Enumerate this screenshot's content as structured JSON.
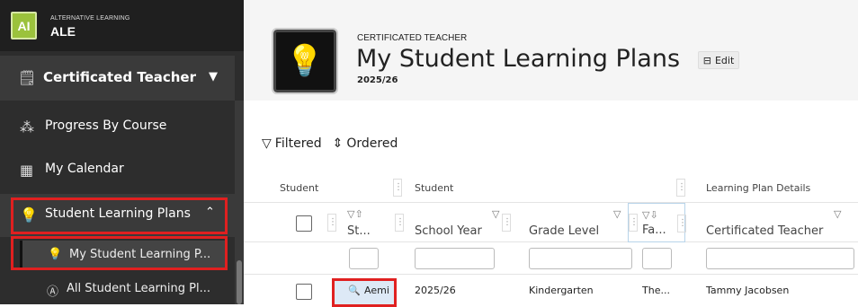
{
  "brand": {
    "logo": "AI",
    "subtitle": "ALTERNATIVE LEARNING",
    "name": "ALE"
  },
  "sidebar": {
    "role": {
      "icon": "teacher-icon",
      "label": "Certificated Teacher"
    },
    "items": [
      {
        "icon": "hierarchy-icon",
        "label": "Progress By Course"
      },
      {
        "icon": "calendar-icon",
        "label": "My Calendar"
      },
      {
        "icon": "lightbulb-icon",
        "label": "Student Learning Plans"
      }
    ],
    "subitems": [
      {
        "icon": "lightbulb-icon",
        "label": "My Student Learning P..."
      },
      {
        "icon": "all-icon",
        "label": "All Student Learning Pl..."
      }
    ]
  },
  "header": {
    "icon": "lightbulb-book-icon",
    "subtitle": "CERTIFICATED TEACHER",
    "title": "My Student Learning Plans",
    "year": "2025/26",
    "edit_label": "Edit"
  },
  "toolbar": {
    "filtered": "Filtered",
    "ordered": "Ordered"
  },
  "table": {
    "groups": [
      "Student",
      "Student",
      "Learning Plan Details"
    ],
    "columns": [
      "St...",
      "School Year",
      "Grade Level",
      "Fa...",
      "Certificated Teacher"
    ],
    "rows": [
      {
        "student": "Aemi",
        "school_year": "2025/26",
        "grade": "Kindergarten",
        "family": "The...",
        "teacher": "Tammy Jacobsen"
      }
    ]
  },
  "colors": {
    "sidebar_bg": "#2d2d2d",
    "highlight": "#e02020",
    "logo": "#9bc23c"
  }
}
